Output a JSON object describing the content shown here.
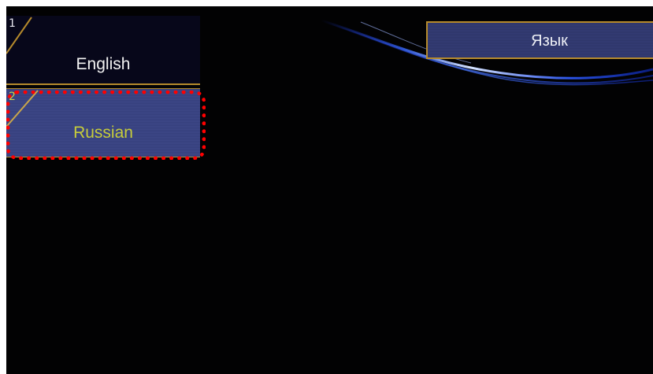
{
  "header": {
    "title": "Язык"
  },
  "menu": {
    "items": [
      {
        "number": "1",
        "label": "English",
        "selected": false
      },
      {
        "number": "2",
        "label": "Russian",
        "selected": true
      }
    ]
  },
  "colors": {
    "background": "#020203",
    "accent_gold": "#b58a2c",
    "selected_item_bg": "#3d4787",
    "selected_text": "#c7cd3a",
    "highlight_outline": "#ff0000"
  }
}
